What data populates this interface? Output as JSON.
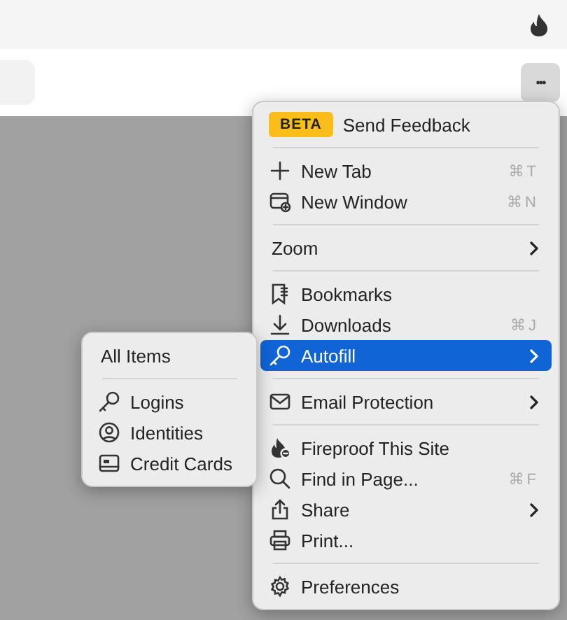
{
  "toolbar": {
    "more_button": "•••"
  },
  "menu": {
    "items": [
      {
        "kind": "feedback",
        "badge": "BETA",
        "label": "Send Feedback",
        "selected": false,
        "submenu": false
      },
      {
        "kind": "separator"
      },
      {
        "kind": "item",
        "label": "New Tab",
        "shortcut": "⌘T",
        "selected": false,
        "submenu": false
      },
      {
        "kind": "item",
        "label": "New Window",
        "shortcut": "⌘N",
        "selected": false,
        "submenu": false
      },
      {
        "kind": "separator"
      },
      {
        "kind": "item",
        "label": "Zoom",
        "selected": false,
        "submenu": true
      },
      {
        "kind": "separator"
      },
      {
        "kind": "item",
        "label": "Bookmarks",
        "selected": false,
        "submenu": false
      },
      {
        "kind": "item",
        "label": "Downloads",
        "shortcut": "⌘J",
        "selected": false,
        "submenu": false
      },
      {
        "kind": "item",
        "label": "Autofill",
        "selected": true,
        "submenu": true
      },
      {
        "kind": "separator"
      },
      {
        "kind": "item",
        "label": "Email Protection",
        "selected": false,
        "submenu": true
      },
      {
        "kind": "separator"
      },
      {
        "kind": "item",
        "label": "Fireproof This Site",
        "selected": false,
        "submenu": false
      },
      {
        "kind": "item",
        "label": "Find in Page...",
        "shortcut": "⌘F",
        "selected": false,
        "submenu": false
      },
      {
        "kind": "item",
        "label": "Share",
        "selected": false,
        "submenu": true
      },
      {
        "kind": "item",
        "label": "Print...",
        "selected": false,
        "submenu": false
      },
      {
        "kind": "separator"
      },
      {
        "kind": "item",
        "label": "Preferences",
        "selected": false,
        "submenu": false
      }
    ]
  },
  "submenu": {
    "items": [
      {
        "kind": "item",
        "label": "All Items",
        "selected": false
      },
      {
        "kind": "separator"
      },
      {
        "kind": "item",
        "label": "Logins",
        "selected": false
      },
      {
        "kind": "item",
        "label": "Identities",
        "selected": false
      },
      {
        "kind": "item",
        "label": "Credit Cards",
        "selected": false
      }
    ]
  }
}
